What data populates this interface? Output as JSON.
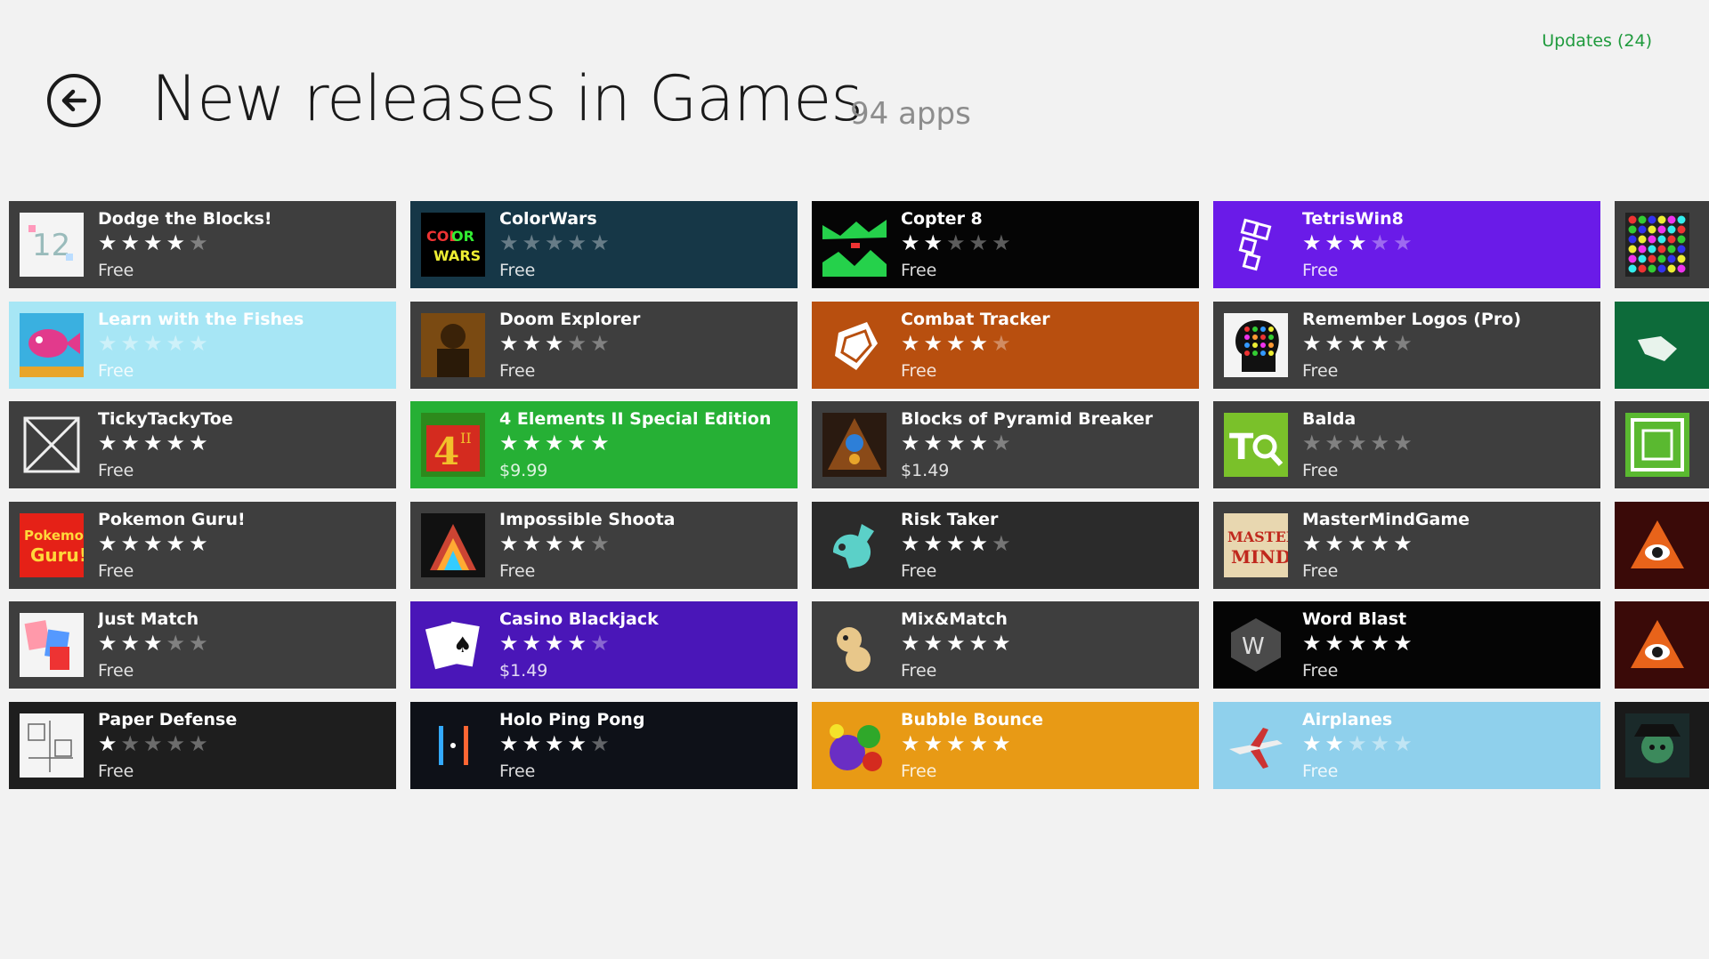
{
  "header": {
    "updates_label": "Updates (24)",
    "title": "New releases in Games",
    "count": "94 apps"
  },
  "tiles": [
    {
      "name": "Dodge the Blocks!",
      "rating": 3.5,
      "price": "Free",
      "bg": "#3e3e3e",
      "icon": "dodge-blocks-icon"
    },
    {
      "name": "ColorWars",
      "rating": 0,
      "price": "Free",
      "bg": "#163747",
      "icon": "colorwars-icon"
    },
    {
      "name": "Copter 8",
      "rating": 2,
      "price": "Free",
      "bg": "#050505",
      "icon": "copter-icon"
    },
    {
      "name": "TetrisWin8",
      "rating": 3,
      "price": "Free",
      "bg": "#6a1be8",
      "icon": "tetris-icon"
    },
    {
      "name": "",
      "rating": 0,
      "price": "",
      "bg": "#3e3e3e",
      "icon": "gems-icon"
    },
    {
      "name": "Learn with the Fishes",
      "rating": 0,
      "price": "Free",
      "bg": "#a7e6f5",
      "icon": "fish-icon"
    },
    {
      "name": "Doom Explorer",
      "rating": 3,
      "price": "Free",
      "bg": "#3e3e3e",
      "icon": "doom-icon"
    },
    {
      "name": "Combat Tracker",
      "rating": 4,
      "price": "Free",
      "bg": "#b84f0f",
      "icon": "combat-shield-icon"
    },
    {
      "name": "Remember Logos (Pro)",
      "rating": 4,
      "price": "Free",
      "bg": "#3e3e3e",
      "icon": "logos-head-icon"
    },
    {
      "name": "",
      "rating": 0,
      "price": "",
      "bg": "#0d6b3a",
      "icon": "glove-icon"
    },
    {
      "name": "TickyTackyToe",
      "rating": 5,
      "price": "Free",
      "bg": "#3e3e3e",
      "icon": "tictactoe-icon"
    },
    {
      "name": "4 Elements II Special Edition",
      "rating": 5,
      "price": "$9.99",
      "bg": "#26b035",
      "icon": "four-elements-icon"
    },
    {
      "name": "Blocks of Pyramid Breaker",
      "rating": 4,
      "price": "$1.49",
      "bg": "#3e3e3e",
      "icon": "pyramid-icon"
    },
    {
      "name": "Balda",
      "rating": 0,
      "price": "Free",
      "bg": "#3e3e3e",
      "icon": "balda-icon"
    },
    {
      "name": "",
      "rating": 0,
      "price": "",
      "bg": "#3e3e3e",
      "icon": "frame-icon"
    },
    {
      "name": "Pokemon Guru!",
      "rating": 5,
      "price": "Free",
      "bg": "#3e3e3e",
      "icon": "pokemon-guru-icon"
    },
    {
      "name": "Impossible Shoota",
      "rating": 4,
      "price": "Free",
      "bg": "#3e3e3e",
      "icon": "shoota-icon"
    },
    {
      "name": "Risk Taker",
      "rating": 4,
      "price": "Free",
      "bg": "#2b2b2b",
      "icon": "risk-taker-icon"
    },
    {
      "name": "MasterMindGame",
      "rating": 5,
      "price": "Free",
      "bg": "#3e3e3e",
      "icon": "mastermind-icon"
    },
    {
      "name": "",
      "rating": 0,
      "price": "",
      "bg": "#3a0a08",
      "icon": "eye-icon"
    },
    {
      "name": "Just Match",
      "rating": 3,
      "price": "Free",
      "bg": "#3e3e3e",
      "icon": "just-match-icon"
    },
    {
      "name": "Casino Blackjack",
      "rating": 3.5,
      "price": "$1.49",
      "bg": "#4a16b8",
      "icon": "cards-icon"
    },
    {
      "name": "Mix&Match",
      "rating": 5,
      "price": "Free",
      "bg": "#3e3e3e",
      "icon": "mix-match-icon"
    },
    {
      "name": "Word Blast",
      "rating": 4.5,
      "price": "Free",
      "bg": "#050505",
      "icon": "word-blast-icon"
    },
    {
      "name": "",
      "rating": 0,
      "price": "",
      "bg": "#3a0a08",
      "icon": "eye-icon"
    },
    {
      "name": "Paper Defense",
      "rating": 1,
      "price": "Free",
      "bg": "#1e1e1e",
      "icon": "paper-defense-icon"
    },
    {
      "name": "Holo Ping Pong",
      "rating": 4,
      "price": "Free",
      "bg": "#0e1118",
      "icon": "ping-pong-icon"
    },
    {
      "name": "Bubble Bounce",
      "rating": 5,
      "price": "Free",
      "bg": "#e89a15",
      "icon": "bubble-icon"
    },
    {
      "name": "Airplanes",
      "rating": 2,
      "price": "Free",
      "bg": "#8fd0ec",
      "icon": "airplane-icon"
    },
    {
      "name": "",
      "rating": 0,
      "price": "",
      "bg": "#1a1a1a",
      "icon": "pirate-icon"
    }
  ]
}
